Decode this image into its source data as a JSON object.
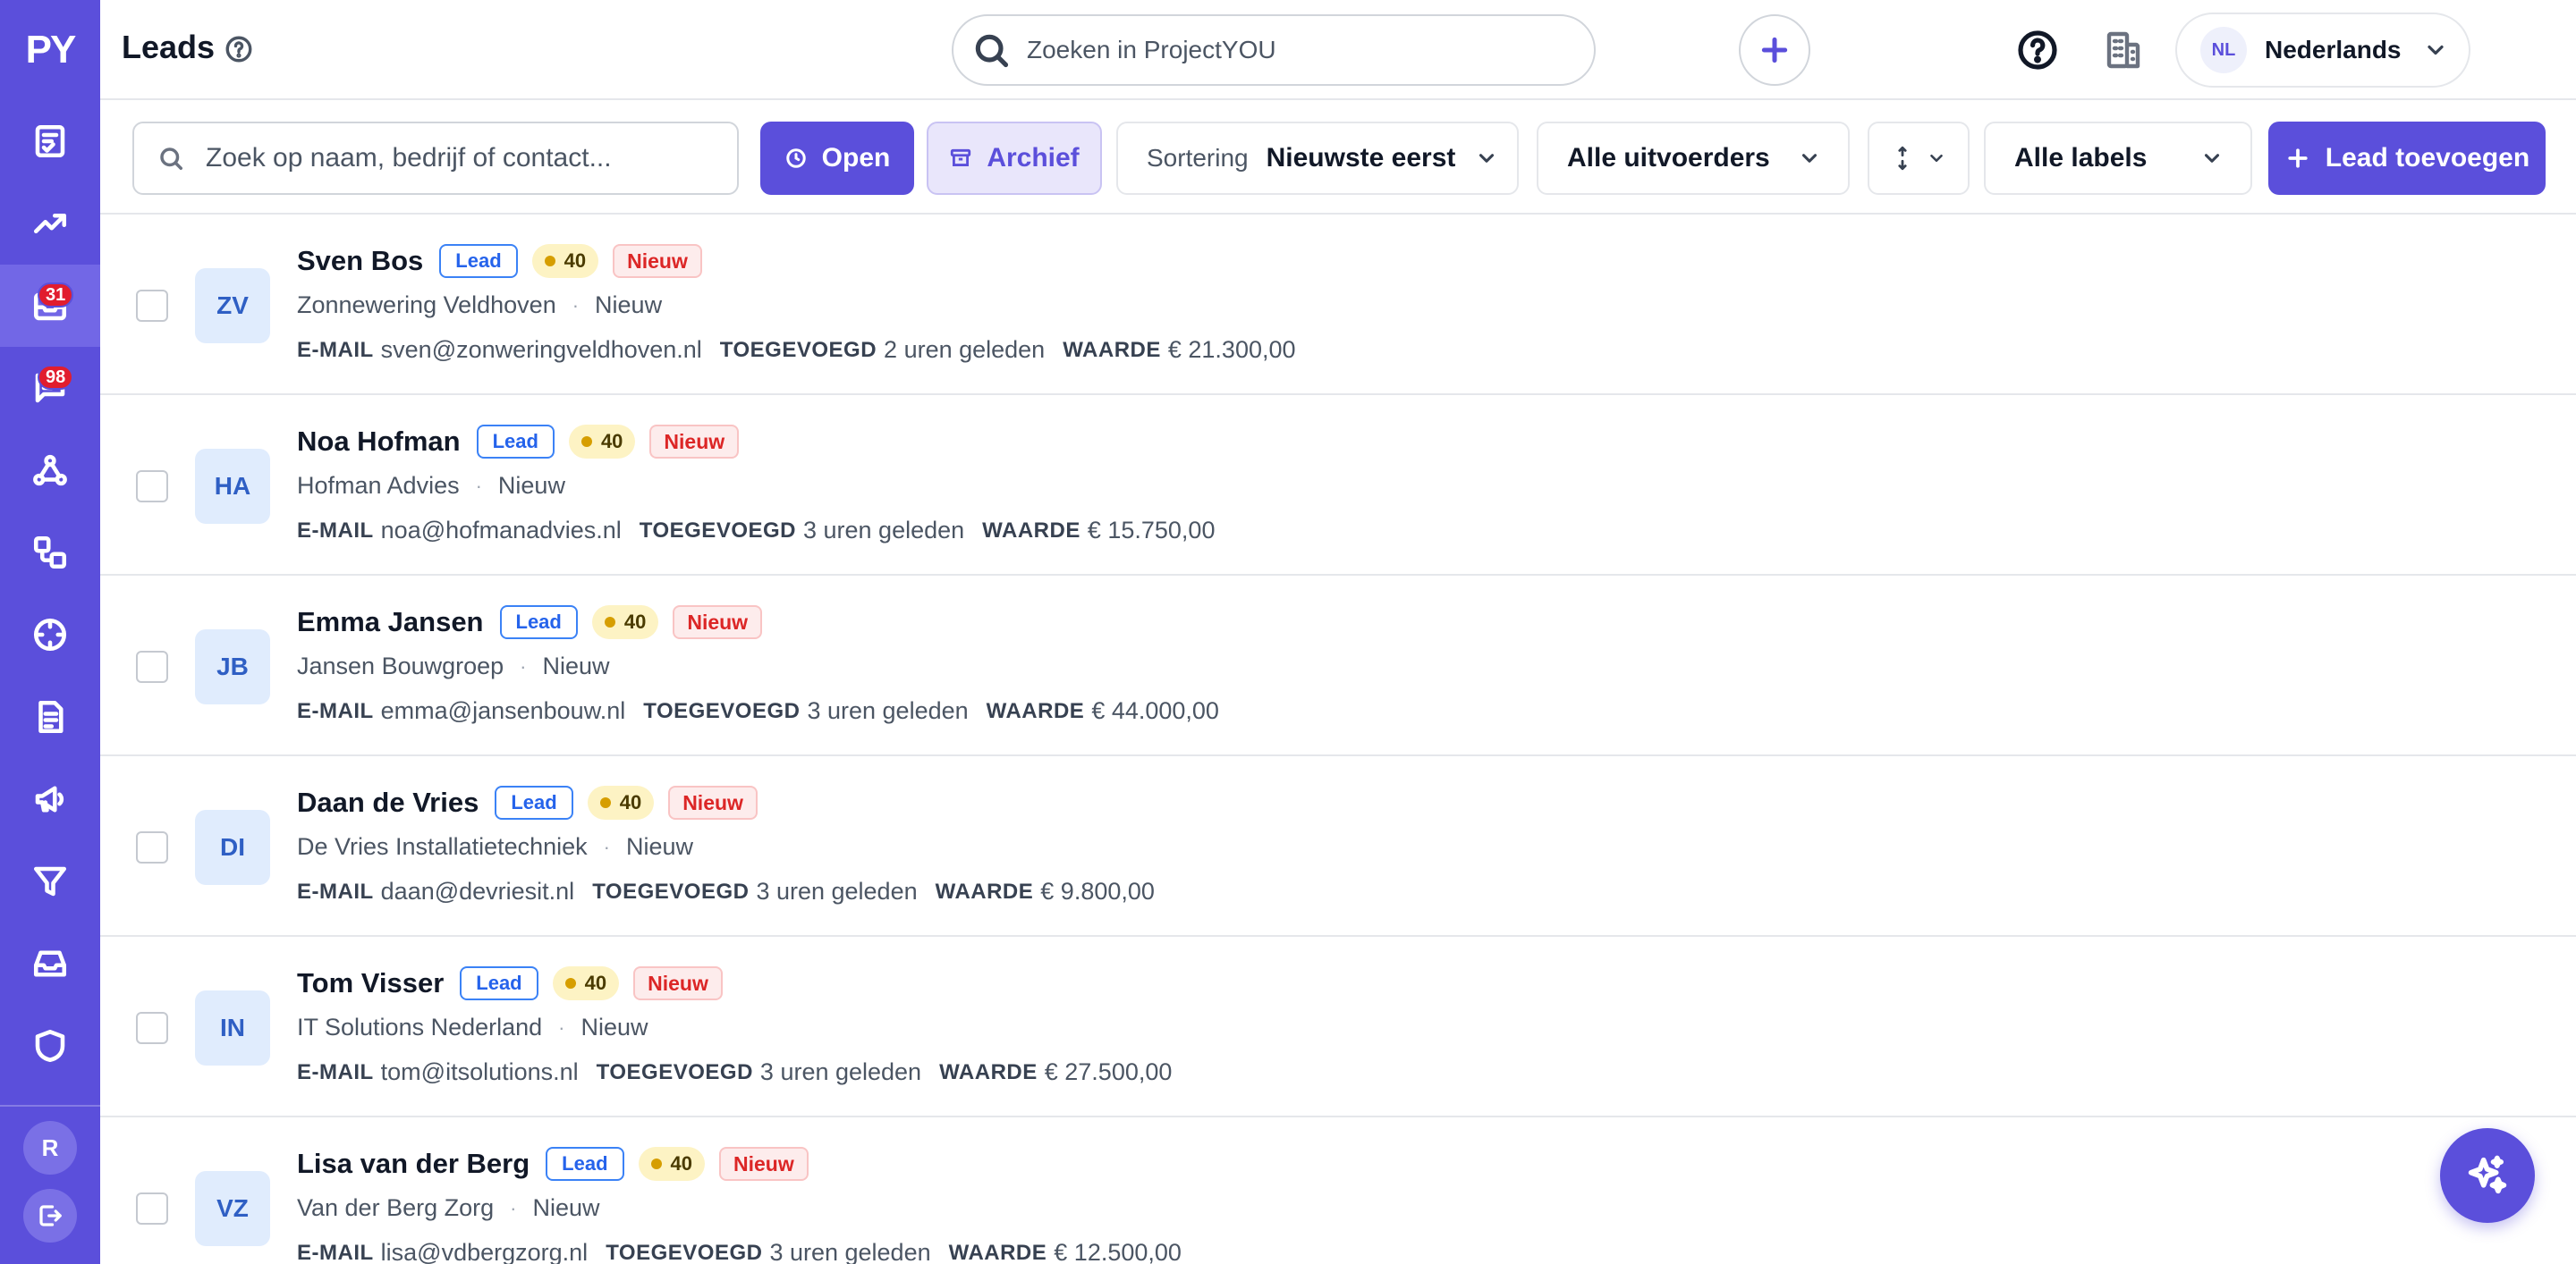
{
  "app": {
    "logo_text": "PY",
    "avatar_initial": "R",
    "accent_color": "#5b4fdb"
  },
  "sidebar": {
    "items": [
      {
        "icon": "clipboard-list-icon",
        "badge": null,
        "active": false
      },
      {
        "icon": "trending-up-icon",
        "badge": null,
        "active": false
      },
      {
        "icon": "inbox-mail-icon",
        "badge": "31",
        "active": true
      },
      {
        "icon": "chat-list-icon",
        "badge": "98",
        "active": false
      },
      {
        "icon": "network-nodes-icon",
        "badge": null,
        "active": false
      },
      {
        "icon": "workflow-icon",
        "badge": null,
        "active": false
      },
      {
        "icon": "crosshair-icon",
        "badge": null,
        "active": false
      },
      {
        "icon": "document-icon",
        "badge": null,
        "active": false
      },
      {
        "icon": "megaphone-icon",
        "badge": null,
        "active": false
      },
      {
        "icon": "filter-icon",
        "badge": null,
        "active": false
      },
      {
        "icon": "inbox-tray-icon",
        "badge": null,
        "active": false
      },
      {
        "icon": "shield-icon",
        "badge": null,
        "active": false
      }
    ]
  },
  "header": {
    "title": "Leads",
    "search_placeholder": "Zoeken in ProjectYOU",
    "language_code": "NL",
    "language_label": "Nederlands"
  },
  "toolbar": {
    "search_placeholder": "Zoek op naam, bedrijf of contact...",
    "open_label": "Open",
    "archive_label": "Archief",
    "sort_prefix": "Sortering",
    "sort_value": "Nieuwste eerst",
    "performer_filter": "Alle uitvoerders",
    "labels_filter": "Alle labels",
    "add_label": "Lead toevoegen"
  },
  "labels": {
    "email_key": "E-MAIL",
    "added_key": "TOEGEVOEGD",
    "value_key": "WAARDE",
    "lead_tag": "Lead",
    "separator": "·"
  },
  "leads": [
    {
      "initials": "ZV",
      "name": "Sven Bos",
      "score": "40",
      "status": "Nieuw",
      "company": "Zonnewering Veldhoven",
      "stage": "Nieuw",
      "email": "sven@zonweringveldhoven.nl",
      "added": "2 uren geleden",
      "value": "€ 21.300,00"
    },
    {
      "initials": "HA",
      "name": "Noa Hofman",
      "score": "40",
      "status": "Nieuw",
      "company": "Hofman Advies",
      "stage": "Nieuw",
      "email": "noa@hofmanadvies.nl",
      "added": "3 uren geleden",
      "value": "€ 15.750,00"
    },
    {
      "initials": "JB",
      "name": "Emma Jansen",
      "score": "40",
      "status": "Nieuw",
      "company": "Jansen Bouwgroep",
      "stage": "Nieuw",
      "email": "emma@jansenbouw.nl",
      "added": "3 uren geleden",
      "value": "€ 44.000,00"
    },
    {
      "initials": "DI",
      "name": "Daan de Vries",
      "score": "40",
      "status": "Nieuw",
      "company": "De Vries Installatietechniek",
      "stage": "Nieuw",
      "email": "daan@devriesit.nl",
      "added": "3 uren geleden",
      "value": "€ 9.800,00"
    },
    {
      "initials": "IN",
      "name": "Tom Visser",
      "score": "40",
      "status": "Nieuw",
      "company": "IT Solutions Nederland",
      "stage": "Nieuw",
      "email": "tom@itsolutions.nl",
      "added": "3 uren geleden",
      "value": "€ 27.500,00"
    },
    {
      "initials": "VZ",
      "name": "Lisa van der Berg",
      "score": "40",
      "status": "Nieuw",
      "company": "Van der Berg Zorg",
      "stage": "Nieuw",
      "email": "lisa@vdbergzorg.nl",
      "added": "3 uren geleden",
      "value": "€ 12.500,00"
    }
  ]
}
